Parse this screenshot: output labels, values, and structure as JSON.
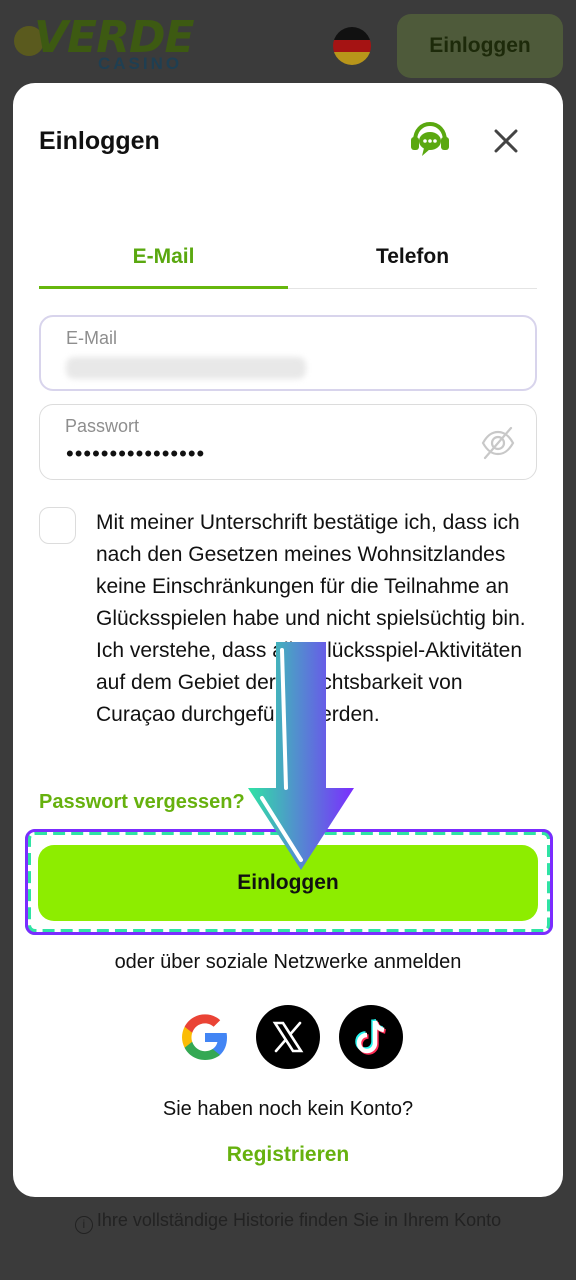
{
  "background": {
    "logo": {
      "main": "VERDE",
      "sub": "CASINO"
    },
    "header_login_label": "Einloggen",
    "footer_text": "Ihre vollständige Historie finden Sie in Ihrem Konto"
  },
  "modal": {
    "title": "Einloggen",
    "tabs": [
      {
        "label": "E-Mail",
        "active": true
      },
      {
        "label": "Telefon",
        "active": false
      }
    ],
    "email_field": {
      "label": "E-Mail",
      "value_blurred": true
    },
    "password_field": {
      "label": "Passwort",
      "value": "••••••••••••••••"
    },
    "terms_text": "Mit meiner Unterschrift bestätige ich, dass ich nach den Gesetzen meines Wohnsitzlandes keine Einschränkungen für die Teilnahme an Glücksspielen habe und nicht spielsüchtig bin. Ich verstehe, dass alle Glücksspiel-Aktivitäten auf dem Gebiet der Gerichtsbarkeit von Curaçao durchgeführt werden.",
    "forgot_password": "Passwort vergessen?",
    "submit_label": "Einloggen",
    "social_text": "oder über soziale Netzwerke anmelden",
    "social_icons": [
      "google-icon",
      "x-icon",
      "tiktok-icon"
    ],
    "no_account_text": "Sie haben noch kein Konto?",
    "register_label": "Registrieren"
  },
  "colors": {
    "accent_green": "#66b10e",
    "button_green": "#8ded00",
    "highlight_teal": "#2fe3a4",
    "highlight_purple": "#7b2cff"
  }
}
